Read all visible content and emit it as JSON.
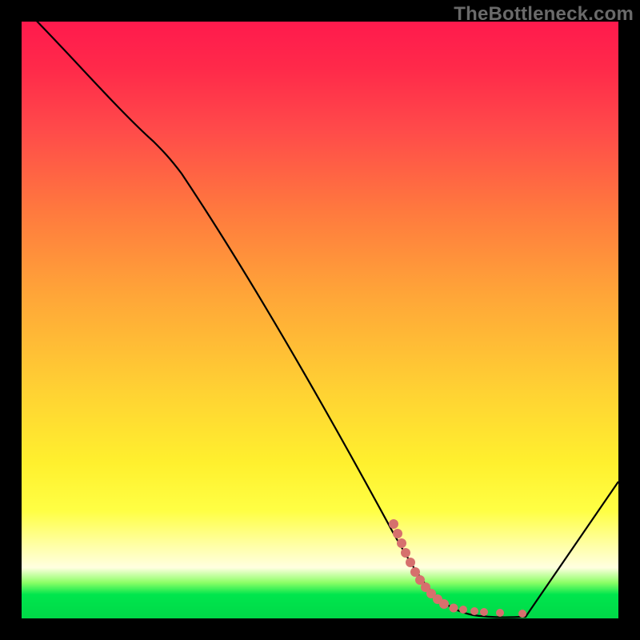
{
  "watermark": "TheBottleneck.com",
  "chart_data": {
    "type": "line",
    "title": "",
    "xlabel": "",
    "ylabel": "",
    "xlim": [
      0,
      100
    ],
    "ylim": [
      0,
      100
    ],
    "series": [
      {
        "name": "main-curve",
        "x": [
          0,
          22,
          63,
          68,
          74,
          80,
          84,
          100
        ],
        "y": [
          100,
          80,
          13,
          6,
          2,
          0,
          0,
          23
        ]
      },
      {
        "name": "dot-segment",
        "x": [
          62.5,
          63.5,
          64.5,
          66,
          67.5,
          69,
          70.5,
          73,
          75.5,
          77,
          80,
          84
        ],
        "y": [
          16,
          13,
          10,
          7,
          5,
          4,
          3,
          2,
          1.5,
          1,
          0.8,
          0.8
        ]
      }
    ],
    "gradient_stops": [
      {
        "pos": 0,
        "color": "#ff1a4d"
      },
      {
        "pos": 0.32,
        "color": "#ff7a3e"
      },
      {
        "pos": 0.62,
        "color": "#ffd233"
      },
      {
        "pos": 0.82,
        "color": "#ffff44"
      },
      {
        "pos": 0.94,
        "color": "#8cff66"
      },
      {
        "pos": 1.0,
        "color": "#00d848"
      }
    ],
    "dot_color": "#d6706d",
    "curve_color": "#000000"
  }
}
